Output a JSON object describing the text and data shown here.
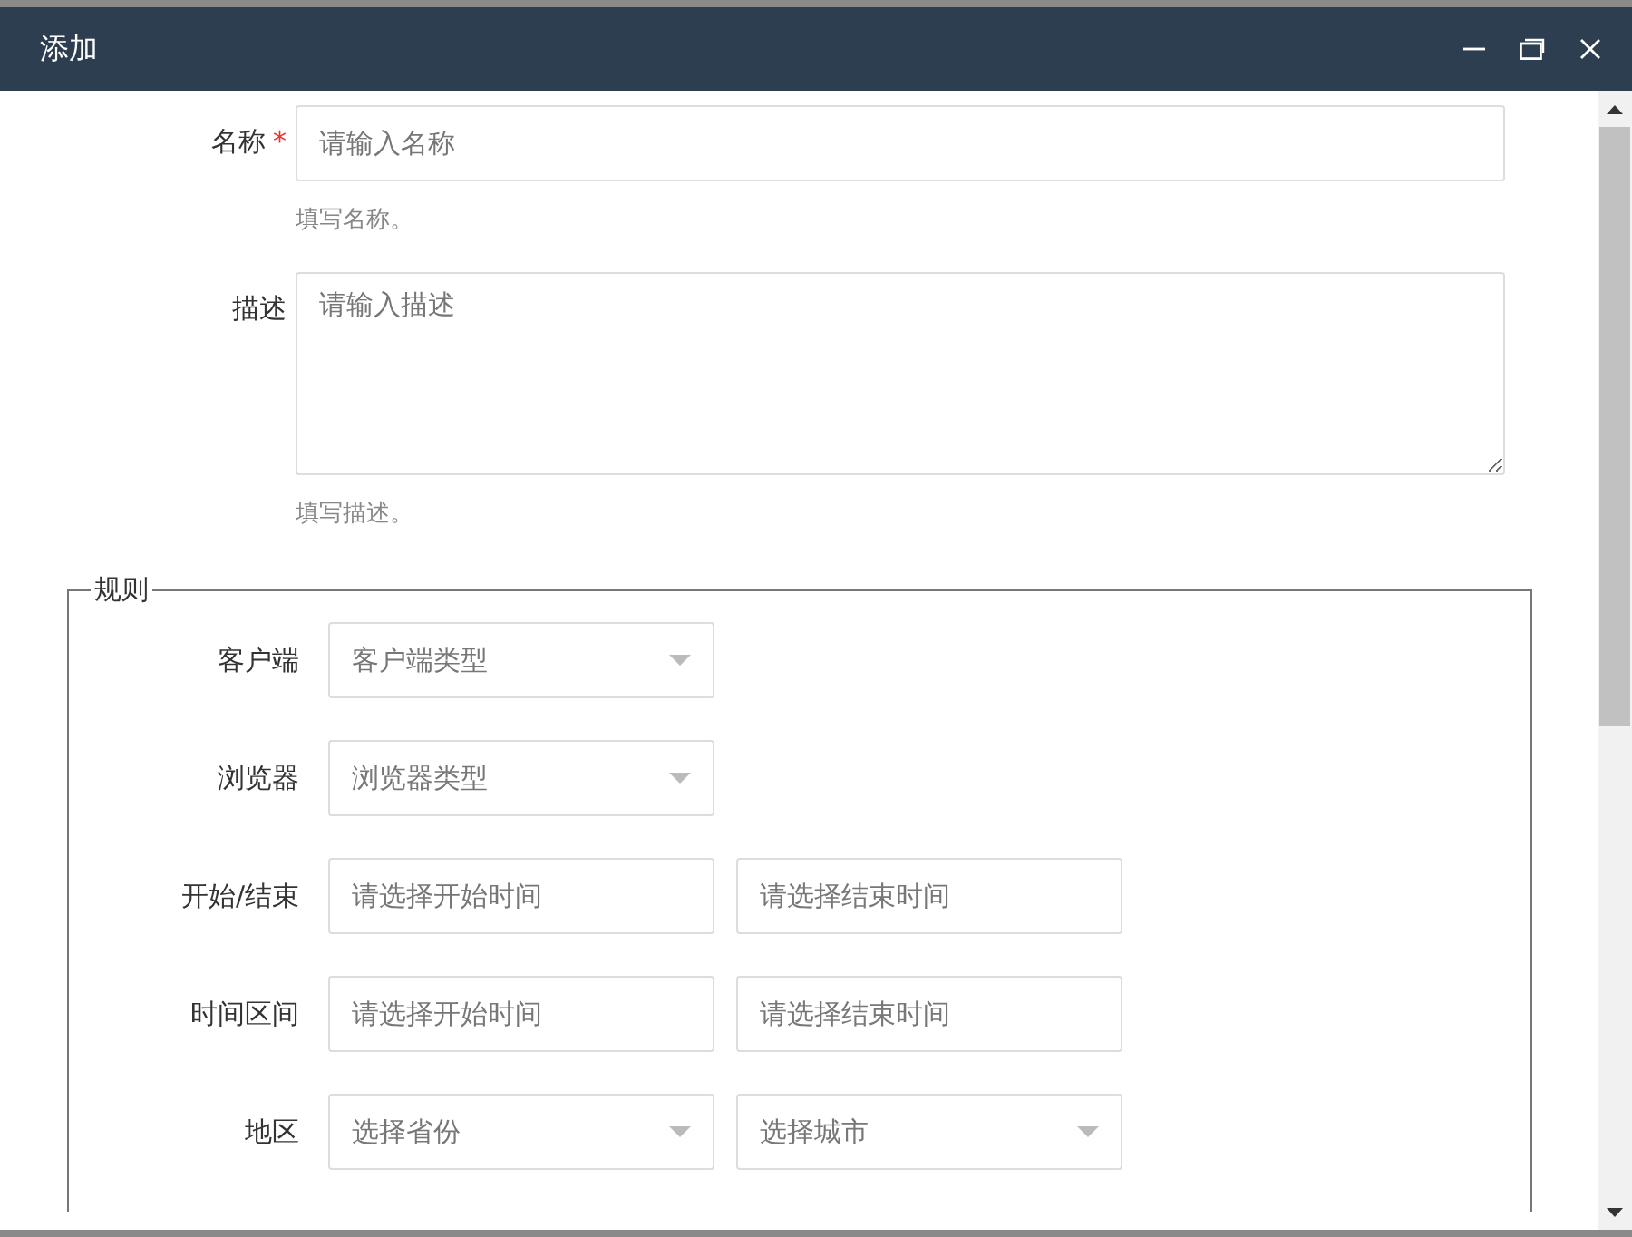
{
  "window": {
    "title": "添加"
  },
  "fields": [
    {
      "kind": "input",
      "label": "名称",
      "required_mark": "*",
      "placeholder": "请输入名称",
      "hint": "填写名称。"
    },
    {
      "kind": "textarea",
      "label": "描述",
      "placeholder": "请输入描述",
      "hint": "填写描述。"
    }
  ],
  "rules": {
    "legend": "规则",
    "rows": [
      {
        "label": "客户端",
        "controls": [
          {
            "kind": "select",
            "placeholder": "客户端类型"
          }
        ]
      },
      {
        "label": "浏览器",
        "controls": [
          {
            "kind": "select",
            "placeholder": "浏览器类型"
          }
        ]
      },
      {
        "label": "开始/结束",
        "controls": [
          {
            "kind": "input",
            "placeholder": "请选择开始时间"
          },
          {
            "kind": "input",
            "placeholder": "请选择结束时间"
          }
        ]
      },
      {
        "label": "时间区间",
        "controls": [
          {
            "kind": "input",
            "placeholder": "请选择开始时间"
          },
          {
            "kind": "input",
            "placeholder": "请选择结束时间"
          }
        ]
      },
      {
        "label": "地区",
        "controls": [
          {
            "kind": "select",
            "placeholder": "选择省份"
          },
          {
            "kind": "select",
            "placeholder": "选择城市"
          }
        ]
      }
    ]
  }
}
